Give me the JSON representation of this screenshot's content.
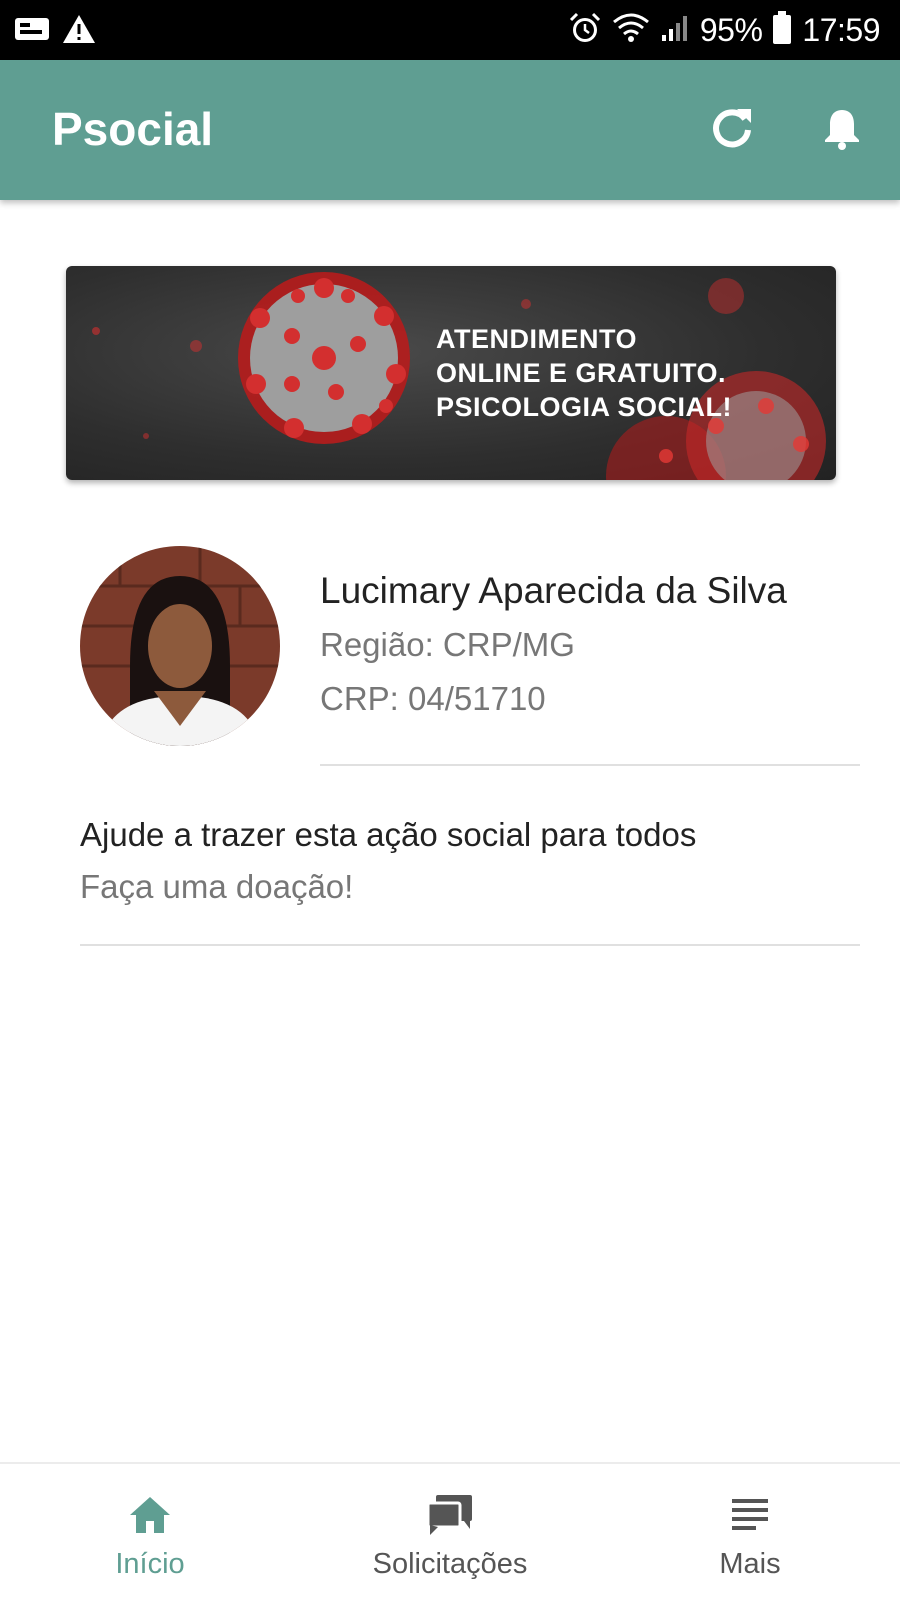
{
  "status_bar": {
    "battery": "95%",
    "time": "17:59",
    "icons": [
      "sim-card-icon",
      "warning-icon",
      "alarm-icon",
      "wifi-icon",
      "signal-icon",
      "battery-icon"
    ]
  },
  "app_bar": {
    "title": "Psocial",
    "actions": [
      "refresh-icon",
      "bell-icon"
    ],
    "color": "#5f9e92"
  },
  "banner": {
    "lines": [
      "ATENDIMENTO",
      "ONLINE E GRATUITO.",
      "PSICOLOGIA SOCIAL!"
    ]
  },
  "profile": {
    "name": "Lucimary Aparecida da Silva",
    "region": "Região: CRP/MG",
    "crp": "CRP: 04/51710"
  },
  "donation": {
    "title": "Ajude a trazer esta ação social para todos",
    "subtitle": "Faça uma doação!"
  },
  "bottom_nav": {
    "items": [
      {
        "label": "Início",
        "icon": "home-icon",
        "active": true
      },
      {
        "label": "Solicitações",
        "icon": "chat-icon",
        "active": false
      },
      {
        "label": "Mais",
        "icon": "menu-lines-icon",
        "active": false
      }
    ],
    "active_color": "#5f9e92"
  }
}
